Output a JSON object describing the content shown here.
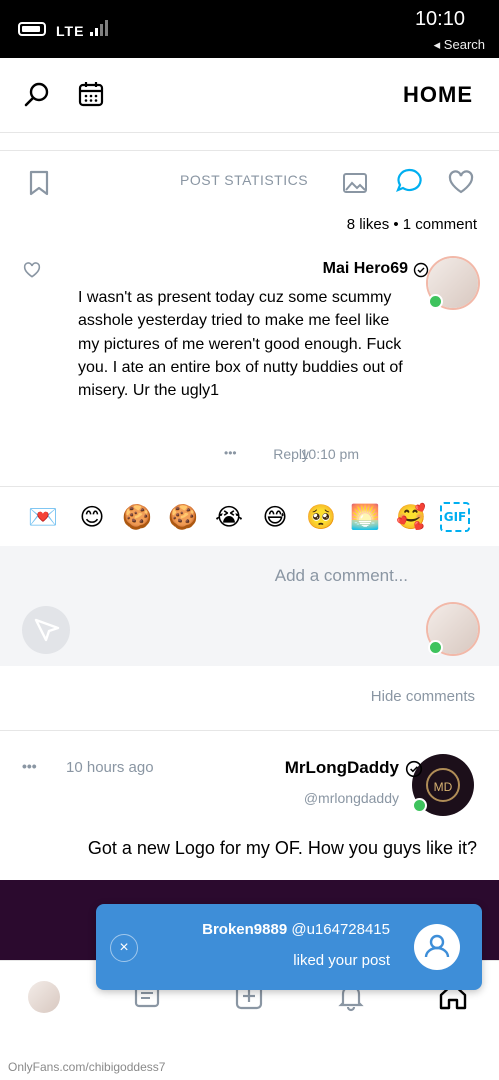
{
  "status_bar": {
    "time": "10:10",
    "back_app": "◂ Search",
    "network": "LTE"
  },
  "header": {
    "title": "HOME"
  },
  "post1": {
    "stats_label": "POST STATISTICS",
    "likes_summary": "8 likes • 1 comment",
    "comment": {
      "author": "Mai Hero69",
      "text": "I wasn't as present today cuz some scummy asshole yesterday tried to make me feel like my pictures of me weren't good enough. Fuck you. I ate an entire box of nutty buddies out of misery. Ur the ugly1",
      "time": "10:10 pm",
      "reply_label": "Reply",
      "more_label": "•••"
    },
    "emojis": [
      "💌",
      "😊",
      "🍪",
      "🍪",
      "😭",
      "😅",
      "🥺",
      "🌅",
      "🥰"
    ],
    "gif_label": "GIF",
    "add_comment_placeholder": "Add a comment...",
    "hide_comments_label": "Hide comments"
  },
  "post2": {
    "author": "MrLongDaddy",
    "handle": "@mrlongdaddy",
    "time_ago": "10 hours ago",
    "more_label": "•••",
    "text": "Got a new Logo for my OF. How you guys like it?",
    "avatar_text": "MD"
  },
  "notification": {
    "user": "Broken9889",
    "user_handle": "@u164728415",
    "message": "liked your post",
    "close_label": "×"
  },
  "watermark": "OnlyFans.com/chibigoddess7",
  "colors": {
    "accent": "#00aff0",
    "notification_bg": "#3e8ed8",
    "muted_text": "#8a96a3",
    "online": "#3ec35d"
  }
}
